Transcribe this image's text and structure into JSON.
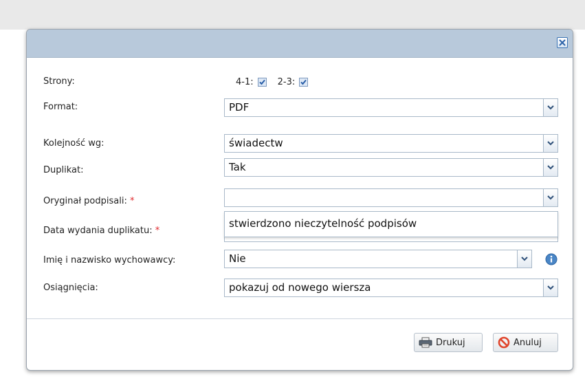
{
  "dialog": {
    "close_label": "×"
  },
  "form": {
    "strony": {
      "label": "Strony:",
      "opt1_label": "4-1:",
      "opt1_checked": true,
      "opt2_label": "2-3:",
      "opt2_checked": true
    },
    "format": {
      "label": "Format:",
      "value": "PDF"
    },
    "kolejnosc": {
      "label": "Kolejność wg:",
      "value": "świadectw"
    },
    "duplikat": {
      "label": "Duplikat:",
      "value": "Tak"
    },
    "oryginal": {
      "label": "Oryginał podpisali:",
      "required_mark": "*",
      "value": "",
      "dropdown_options": [
        "stwierdzono nieczytelność podpisów"
      ]
    },
    "data_wydania": {
      "label": "Data wydania duplikatu:",
      "required_mark": "*",
      "value": ""
    },
    "wychowawca": {
      "label": "Imię i nazwisko wychowawcy:",
      "value": "Nie"
    },
    "osiagniecia": {
      "label": "Osiągnięcia:",
      "value": "pokazuj od nowego wiersza"
    }
  },
  "buttons": {
    "print_label": "Drukuj",
    "cancel_label": "Anuluj"
  },
  "colors": {
    "titlebar": "#b8c9db",
    "required": "#e0282c",
    "info": "#4a86c6",
    "cancel_icon": "#e0452c"
  }
}
